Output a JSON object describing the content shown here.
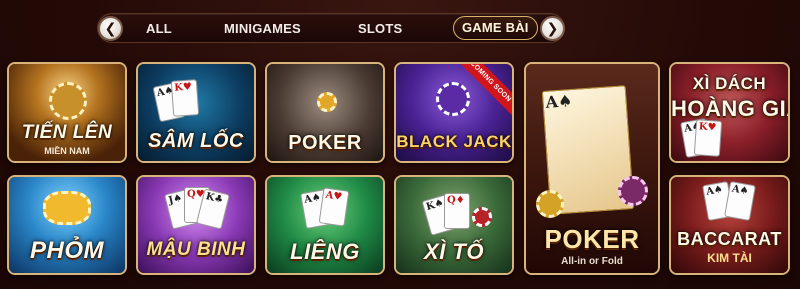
{
  "nav": {
    "prev_icon": "chevron-left-icon",
    "next_icon": "chevron-right-icon",
    "prev_glyph": "❮",
    "next_glyph": "❯",
    "tabs": [
      {
        "label": "ALL"
      },
      {
        "label": "MINIGAMES"
      },
      {
        "label": "SLOTS"
      },
      {
        "label": "GAME BÀI",
        "active": true
      }
    ]
  },
  "games": [
    {
      "title": "TIẾN LÊN",
      "subtitle": "MIỀN NAM"
    },
    {
      "title": "SÂM LỐC"
    },
    {
      "title": "POKER"
    },
    {
      "title": "BLACK JACK",
      "badge": "COMING SOON"
    },
    {
      "title": "POKER",
      "subtitle": "All-in or Fold"
    },
    {
      "title": "XÌ DÁCH",
      "subtitle": "HOÀNG GIA"
    },
    {
      "title": "PHỎM"
    },
    {
      "title": "MẬU BINH"
    },
    {
      "title": "LIÊNG"
    },
    {
      "title": "XÌ TỐ"
    },
    {
      "title": "BACCARAT",
      "subtitle": "KIM TÀI"
    }
  ],
  "colors": {
    "accent_gold": "#d8b47a",
    "background": "#240a07"
  }
}
